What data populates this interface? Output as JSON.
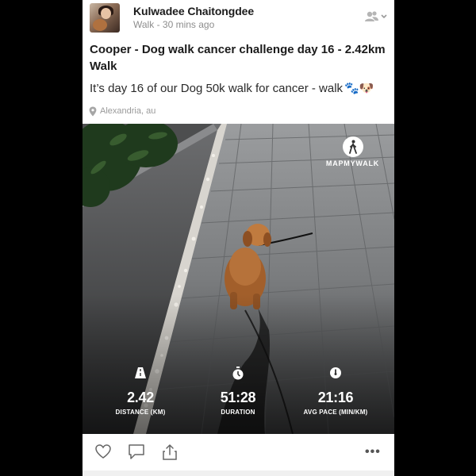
{
  "post": {
    "user_name": "Kulwadee Chaitongdee",
    "activity_type": "Walk",
    "time_ago": "30 mins ago",
    "meta_separator": " - ",
    "title": "Cooper - Dog walk cancer challenge day 16 - 2.42km Walk",
    "description": "It’s day 16 of our Dog 50k walk for cancer - walk",
    "description_emojis": "🐾🐶",
    "location": "Alexandria, au"
  },
  "photo": {
    "brand": "MAPMYWALK",
    "stats": [
      {
        "icon": "road-icon",
        "value": "2.42",
        "label": "DISTANCE (KM)"
      },
      {
        "icon": "stopwatch-icon",
        "value": "51:28",
        "label": "DURATION"
      },
      {
        "icon": "gauge-icon",
        "value": "21:16",
        "label": "AVG PACE (MIN/KM)"
      }
    ]
  },
  "actions": {
    "like": "heart-icon",
    "comment": "comment-icon",
    "share": "share-icon",
    "more": "•••"
  },
  "colors": {
    "text_primary": "#1b1b1b",
    "text_muted": "#8d8d8d",
    "stat_text": "#ffffff"
  }
}
